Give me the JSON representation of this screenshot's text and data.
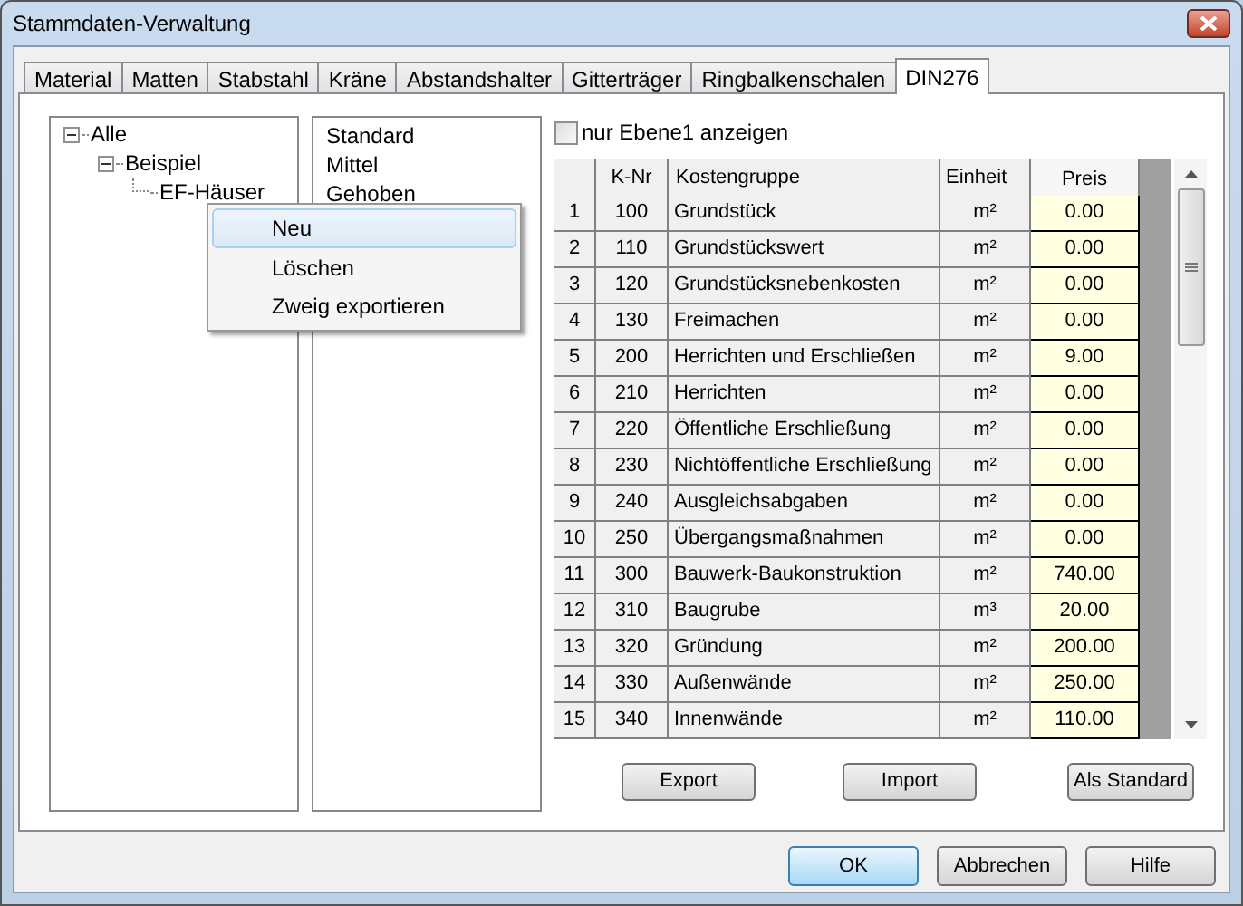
{
  "window": {
    "title": "Stammdaten-Verwaltung"
  },
  "tabs": [
    {
      "label": "Material",
      "selected": false
    },
    {
      "label": "Matten",
      "selected": false
    },
    {
      "label": "Stabstahl",
      "selected": false
    },
    {
      "label": "Kräne",
      "selected": false
    },
    {
      "label": "Abstandshalter",
      "selected": false
    },
    {
      "label": "Gitterträger",
      "selected": false
    },
    {
      "label": "Ringbalkenschalen",
      "selected": false
    },
    {
      "label": "DIN276",
      "selected": true
    }
  ],
  "tree": [
    {
      "label": "Alle",
      "expanded": true,
      "children": [
        {
          "label": "Beispiel",
          "expanded": true,
          "children": [
            {
              "label": "EF-Häuser"
            }
          ]
        }
      ]
    }
  ],
  "levels": [
    "Standard",
    "Mittel",
    "Gehoben"
  ],
  "context_menu": [
    {
      "label": "Neu",
      "selected": true
    },
    {
      "label": "Löschen",
      "selected": false
    },
    {
      "label": "Zweig exportieren",
      "selected": false
    }
  ],
  "filter_checkbox": {
    "label": "nur Ebene1 anzeigen",
    "checked": false
  },
  "table": {
    "columns": [
      "",
      "K-Nr",
      "Kostengruppe",
      "Einheit",
      "Preis"
    ],
    "rows": [
      [
        "1",
        "100",
        "Grundstück",
        "m²",
        "0.00"
      ],
      [
        "2",
        "110",
        "Grundstückswert",
        "m²",
        "0.00"
      ],
      [
        "3",
        "120",
        "Grundstücksnebenkosten",
        "m²",
        "0.00"
      ],
      [
        "4",
        "130",
        "Freimachen",
        "m²",
        "0.00"
      ],
      [
        "5",
        "200",
        "Herrichten und Erschließen",
        "m²",
        "9.00"
      ],
      [
        "6",
        "210",
        "Herrichten",
        "m²",
        "0.00"
      ],
      [
        "7",
        "220",
        "Öffentliche Erschließung",
        "m²",
        "0.00"
      ],
      [
        "8",
        "230",
        "Nichtöffentliche Erschließung",
        "m²",
        "0.00"
      ],
      [
        "9",
        "240",
        "Ausgleichsabgaben",
        "m²",
        "0.00"
      ],
      [
        "10",
        "250",
        "Übergangsmaßnahmen",
        "m²",
        "0.00"
      ],
      [
        "11",
        "300",
        "Bauwerk-Baukonstruktion",
        "m²",
        "740.00"
      ],
      [
        "12",
        "310",
        "Baugrube",
        "m³",
        "20.00"
      ],
      [
        "13",
        "320",
        "Gründung",
        "m²",
        "200.00"
      ],
      [
        "14",
        "330",
        "Außenwände",
        "m²",
        "250.00"
      ],
      [
        "15",
        "340",
        "Innenwände",
        "m²",
        "110.00"
      ]
    ]
  },
  "table_buttons": [
    "Export",
    "Import",
    "Als Standard"
  ],
  "dialog_buttons": [
    {
      "label": "OK",
      "default": true
    },
    {
      "label": "Abbrechen",
      "default": false
    },
    {
      "label": "Hilfe",
      "default": false
    }
  ]
}
